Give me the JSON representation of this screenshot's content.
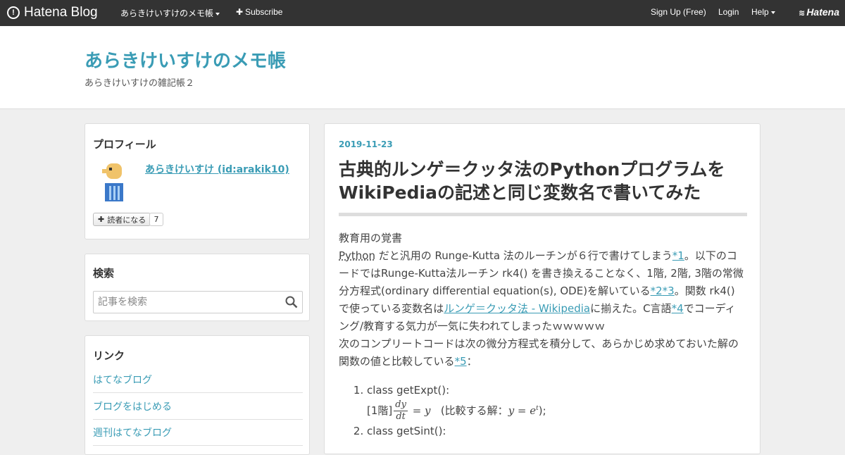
{
  "topbar": {
    "logo_text": "Hatena Blog",
    "blog_menu": "あらきけいすけのメモ帳",
    "subscribe": "Subscribe",
    "signup": "Sign Up (Free)",
    "login": "Login",
    "help": "Help",
    "hatena": "Hatena"
  },
  "header": {
    "title": "あらきけいすけのメモ帳",
    "description": "あらきけいすけの雑記帳２"
  },
  "profile": {
    "heading": "プロフィール",
    "name": "あらきけいすけ (id:arakik10)",
    "subscribe_label": "読者になる",
    "subscriber_count": "7"
  },
  "search": {
    "heading": "検索",
    "placeholder": "記事を検索"
  },
  "links": {
    "heading": "リンク",
    "items": [
      "はてなブログ",
      "ブログをはじめる",
      "週刊はてなブログ"
    ]
  },
  "entry": {
    "date": "2019-11-23",
    "title": "古典的ルンゲ＝クッタ法のPythonプログラムをWikiPediaの記述と同じ変数名で書いてみた",
    "p1": "教育用の覚書",
    "p2_a": "Python",
    "p2_b": " だと汎用の Runge-Kutta 法のルーチンが６行で書けてしまう",
    "fn1": "*1",
    "p2_c": "。以下のコードではRunge-Kutta法ルーチン rk4() を書き換えることなく、1階, 2階, 3階の常微分方程式(ordinary differential equation(s), ODE)を解いている",
    "fn2": "*2",
    "fn3": "*3",
    "p2_d": "。関数 rk4() で使っている変数名は",
    "wiki_link": "ルンゲ＝クッタ法 - Wikipedia",
    "p2_e": "に揃えた。C言語",
    "fn4": "*4",
    "p2_f": "でコーディング/教育する気力が一気に失われてしまったｗｗｗｗｗ",
    "p3_a": "次のコンプリートコードは次の微分方程式を積分して、あらかじめ求めておいた解の関数の値と比較している",
    "fn5": "*5",
    "p3_b": "：",
    "li1": "class getExpt():",
    "li1_order": "[1階]",
    "li1_num": "dy",
    "li1_den": "dt",
    "li1_eq": " = y",
    "li1_compare": "(比較する解：",
    "li1_sol": "y = e",
    "li1_sup": "t",
    "li1_end": ");",
    "li2": "class getSint():"
  }
}
